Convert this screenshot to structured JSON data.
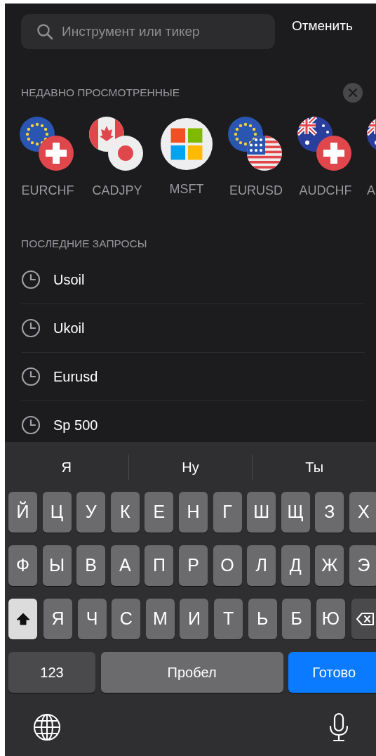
{
  "search": {
    "placeholder": "Инструмент или тикер",
    "cancel": "Отменить"
  },
  "recently_viewed": {
    "title": "НЕДАВНО ПРОСМОТРЕННЫЕ",
    "items": [
      {
        "label": "EURCHF"
      },
      {
        "label": "CADJPY"
      },
      {
        "label": "MSFT"
      },
      {
        "label": "EURUSD"
      },
      {
        "label": "AUDCHF"
      },
      {
        "label": "A"
      }
    ]
  },
  "recent_queries": {
    "title": "ПОСЛЕДНИЕ ЗАПРОСЫ",
    "items": [
      "Usoil",
      "Ukoil",
      "Eurusd",
      "Sp 500"
    ]
  },
  "keyboard": {
    "suggestions": [
      "Я",
      "Ну",
      "Ты"
    ],
    "rows": [
      [
        "Й",
        "Ц",
        "У",
        "К",
        "Е",
        "Н",
        "Г",
        "Ш",
        "Щ",
        "З",
        "Х"
      ],
      [
        "Ф",
        "Ы",
        "В",
        "А",
        "П",
        "Р",
        "О",
        "Л",
        "Д",
        "Ж",
        "Э"
      ]
    ],
    "shift_row": {
      "shift": {
        "active": true
      },
      "keys": [
        "Я",
        "Ч",
        "С",
        "М",
        "И",
        "Т",
        "Ь",
        "Б",
        "Ю"
      ]
    },
    "numbers_key": "123",
    "space_key": "Пробел",
    "done_key": "Готово"
  }
}
